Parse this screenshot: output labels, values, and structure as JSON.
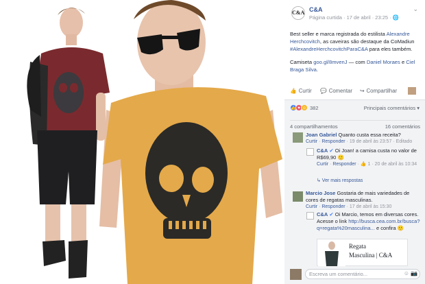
{
  "page": {
    "name": "C&A",
    "logo_text": "C&A",
    "meta": "Página curtida · 17 de abril · 23:25 · ",
    "globe": "🌐",
    "more": "⌄"
  },
  "post": {
    "text1": "Best seller e marca registrada do estilista ",
    "link1": "Alexandre Herchcovitch",
    "text2": ", as caveiras são destaque da CoMadiun ",
    "link2": "#AlexandreHerchcovitchParaC&A",
    "text3": " para eles também.",
    "line2a": "Camiseta ",
    "line2link": "goo.gl/8mvenJ",
    "line2b": " — com ",
    "tag1": "Daniel Moraes",
    "line2c": " e ",
    "tag2": "Ciel Braga Silva",
    "line2d": "."
  },
  "actions": {
    "like": "Curtir",
    "comment": "Comentar",
    "share": "Compartilhar",
    "like_icon": "👍",
    "comment_icon": "💬",
    "share_icon": "↪"
  },
  "reactions": {
    "count": "382",
    "sort": "Principais comentários ▾"
  },
  "stats": {
    "shares": "4 compartilhamentos",
    "comments": "16 comentários"
  },
  "comments": [
    {
      "name": "Joan Gabriel",
      "text": "Quanto custa essa receita?",
      "like": "Curtir",
      "reply": "Responder",
      "time": "19 de abril às 23:57",
      "edited": "Editado"
    },
    {
      "name": "C&A",
      "text": "Oi Joan! a camisa custa no valor de R$69,90 🙂",
      "like": "Curtir",
      "reply": "Responder",
      "reacts": "1",
      "time": "20 de abril às 10:34"
    },
    {
      "more_replies": "↳ Ver mais respostas"
    },
    {
      "name": "Marcio Jose",
      "text": "Gostaria de mais variedades de cores de regatas masculinas.",
      "like": "Curtir",
      "reply": "Responder",
      "time": "17 de abril às 15:30"
    },
    {
      "name": "C&A",
      "text": "Oi Marcio, temos em diversas cores. Acesse o link",
      "link": "http://busca.cea.com.br/busca?q=regata%20masculina...",
      "link_suffix": "e confira 🙂"
    }
  ],
  "preview": {
    "title1": "Regata",
    "title2": "Masculina | C&A"
  },
  "compose": {
    "placeholder": "Escreva um comentário...",
    "icon1": "☺",
    "icon2": "📷"
  },
  "colors": {
    "link": "#365899",
    "tee_mustard": "#e4a94a",
    "tee_burgundy": "#7a2a2e"
  }
}
